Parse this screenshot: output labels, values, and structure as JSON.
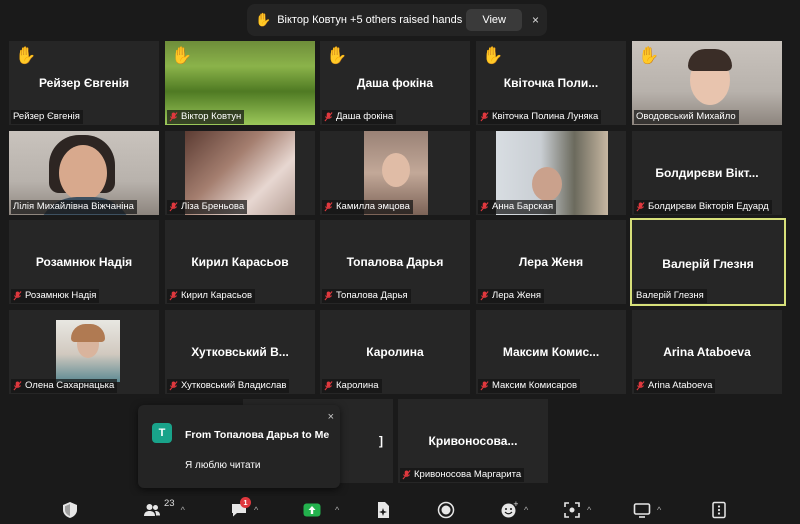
{
  "notice": {
    "text": "Віктор Ковтун +5 others raised hands",
    "view_label": "View",
    "close": "×"
  },
  "tiles": [
    {
      "center": "Рейзер Євгенія",
      "label": "Рейзер Євгенія",
      "hand": true
    },
    {
      "center": "",
      "label": "Віктор Ковтун",
      "hand": true
    },
    {
      "center": "Даша фокіна",
      "label": "Даша фокіна",
      "hand": true
    },
    {
      "center": "Квіточка  Поли...",
      "label": "Квіточка Полина Луняка",
      "hand": true
    },
    {
      "center": "",
      "label": "Оводовський Михайло",
      "hand": true
    },
    {
      "center": "",
      "label": "Лілія Михайлівна Віжчаніна",
      "hand": false
    },
    {
      "center": "",
      "label": "Ліза Бреньова",
      "hand": false
    },
    {
      "center": "",
      "label": "Камилла эмцова",
      "hand": false
    },
    {
      "center": "",
      "label": "Анна Барская",
      "hand": false
    },
    {
      "center": "Болдирєви Вікт...",
      "label": "Болдирєви Вікторія Едуард",
      "hand": false
    },
    {
      "center": "Розамнюк Надія",
      "label": "Розамнюк Надія",
      "hand": false
    },
    {
      "center": "Кирил Карасьов",
      "label": "Кирил Карасьов",
      "hand": false
    },
    {
      "center": "Топалова Дарья",
      "label": "Топалова Дарья",
      "hand": false
    },
    {
      "center": "Лера Женя",
      "label": "Лера Женя",
      "hand": false
    },
    {
      "center": "Валерій Глезня",
      "label": "Валерій Глезня",
      "hand": false
    },
    {
      "center": "",
      "label": "Олена Сахарнацька",
      "hand": false
    },
    {
      "center": "Хутковський  В...",
      "label": "Хутковський Владислав",
      "hand": false
    },
    {
      "center": "Каролина",
      "label": "Каролина",
      "hand": false
    },
    {
      "center": "Максим  Комис...",
      "label": "Максим Комисаров",
      "hand": false
    },
    {
      "center": "Arina Ataboeva",
      "label": "Arina Ataboeva",
      "hand": false
    },
    {
      "center": "Кривоносова...",
      "label": "Кривоносова Маргарита",
      "hand": false
    },
    {
      "center": "]",
      "label": "",
      "hand": false
    }
  ],
  "chat_popup": {
    "avatar_letter": "T",
    "from": "From Топалова Дарья to Me",
    "message": "Я люблю читати",
    "close": "×"
  },
  "toolbar": {
    "participants_count": "23",
    "chat_badge": "1",
    "icons": [
      "security-icon",
      "participants-icon",
      "chat-icon",
      "share-screen-icon",
      "summary-icon",
      "record-icon",
      "reactions-icon",
      "apps-icon",
      "whiteboard-icon",
      "more-icon"
    ]
  },
  "colors": {
    "background": "#1a1a1a",
    "tile": "#262626",
    "active_speaker": "#d7e07a",
    "hand": "#f7c03c",
    "muted": "#e0383e",
    "share_green": "#23b14d",
    "chat_avatar": "#19a38a"
  }
}
